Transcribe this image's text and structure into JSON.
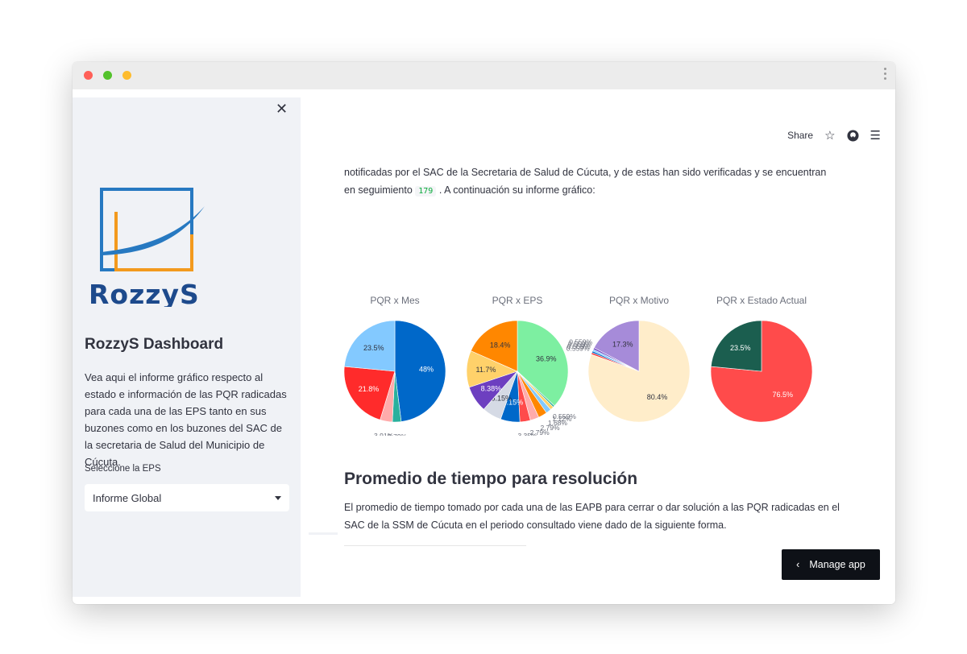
{
  "sidebar": {
    "logo_text": "RozzyS",
    "title": "RozzyS Dashboard",
    "description": "Vea aqui el informe gráfico respecto al estado e información de las PQR radicadas para cada una de las EPS tanto en sus buzones como en los buzones del SAC de la secretaria de Salud del Municipio de Cúcuta.",
    "select_label": "Seleccione la EPS",
    "select_value": "Informe Global"
  },
  "header": {
    "share_label": "Share"
  },
  "main": {
    "intro_line1": "notificadas por el SAC de la Secretaria de Salud de Cúcuta, y de estas han sido verificadas y se encuentran",
    "intro_line2_pre": "en seguimiento",
    "intro_code": "179",
    "intro_line2_post": ". A continuación su informe gráfico:",
    "section_heading": "Promedio de tiempo para resolución",
    "section_text": "El promedio de tiempo tomado por cada una de las EAPB para cerrar o dar solución a las PQR radicadas en el SAC de la SSM de Cúcuta en el periodo consultado viene dado de la siguiente forma.",
    "manage_label": "Manage app"
  },
  "colors": {
    "sidebar_bg": "#f0f2f6",
    "dark_button": "#0e1117",
    "code_green": "#09ab3b"
  },
  "chart_data": [
    {
      "type": "pie",
      "title": "PQR x Mes",
      "values": [
        48,
        2.79,
        3.91,
        21.8,
        23.5
      ],
      "labels": [
        "48%",
        "2.79%",
        "3.91%",
        "21.8%",
        "23.5%"
      ],
      "colors": [
        "#0068c9",
        "#29b09d",
        "#ffabab",
        "#ff2b2b",
        "#83c9ff"
      ]
    },
    {
      "type": "pie",
      "title": "PQR x EPS",
      "values": [
        36.9,
        0.559,
        1.12,
        1.68,
        2.79,
        2.79,
        3.35,
        6.15,
        6.15,
        8.38,
        11.7,
        18.4
      ],
      "labels": [
        "36.9%",
        "0.559%",
        "1.12%",
        "1.68%",
        "2.79%",
        "2.79%",
        "3.35%",
        "6.15%",
        "6.15%",
        "8.38%",
        "11.7%",
        "18.4%"
      ],
      "colors": [
        "#7defa1",
        "#29b09d",
        "#ffd16a",
        "#83c9ff",
        "#ff8700",
        "#ffabab",
        "#ff4b4b",
        "#0068c9",
        "#d5dae5",
        "#6d3fc0",
        "#ffd16a",
        "#ff8700"
      ]
    },
    {
      "type": "pie",
      "title": "PQR x Motivo",
      "values": [
        80.4,
        0.559,
        0.559,
        0.559,
        0.559,
        17.3
      ],
      "labels": [
        "80.4%",
        "0.559%",
        "0.559%",
        "0.559%",
        "0.559%",
        "17.3%"
      ],
      "colors": [
        "#ffedca",
        "#ff2b2b",
        "#0068c9",
        "#83c9ff",
        "#6d3fc0",
        "#a68bd9"
      ]
    },
    {
      "type": "pie",
      "title": "PQR x Estado Actual",
      "values": [
        76.5,
        23.5
      ],
      "labels": [
        "76.5%",
        "23.5%"
      ],
      "colors": [
        "#ff4b4b",
        "#1b5e4f"
      ]
    }
  ]
}
